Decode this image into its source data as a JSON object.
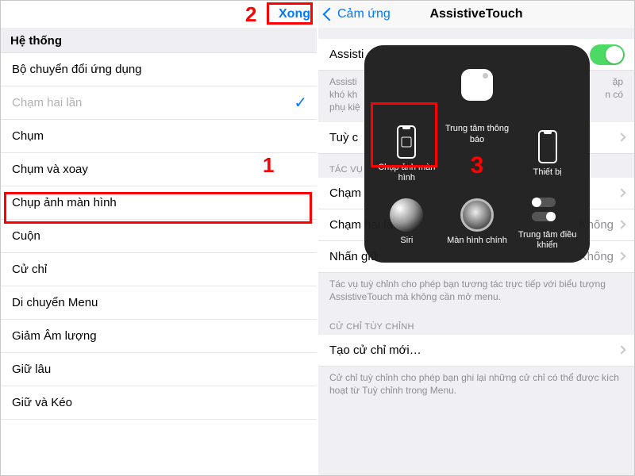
{
  "left": {
    "nav": {
      "done": "Xong"
    },
    "section": "Hệ thống",
    "items": [
      "Bộ chuyển đổi ứng dụng",
      "Chạm hai lần",
      "Chụm",
      "Chụm và xoay",
      "Chụp ảnh màn hình",
      "Cuộn",
      "Cử chỉ",
      "Di chuyển Menu",
      "Giảm Âm lượng",
      "Giữ lâu",
      "Giữ và Kéo"
    ],
    "steps": {
      "one": "1",
      "two": "2"
    }
  },
  "right": {
    "nav": {
      "back": "Cảm ứng",
      "title": "AssistiveTouch"
    },
    "assistive_row": "Assisti",
    "assistive_desc_a": "Assisti",
    "assistive_desc_b": "khó kh",
    "assistive_desc_c": "phụ kiệ",
    "assistive_desc_tail_a": "ặp",
    "assistive_desc_tail_b": "n có",
    "customize": "Tuỳ c",
    "section_actions": "TÁC VỤ",
    "actions": [
      {
        "label": "Chạm",
        "value": ""
      },
      {
        "label": "Chạm hai lần",
        "value": "Không"
      },
      {
        "label": "Nhấn giữ",
        "value": "Không"
      }
    ],
    "actions_footer": "Tác vụ tuỳ chỉnh cho phép bạn tương tác trực tiếp với biểu tượng AssistiveTouch mà không cần mở menu.",
    "section_gestures": "CỬ CHỈ TÙY CHỈNH",
    "create_gesture": "Tạo cử chỉ mới…",
    "gestures_footer": "Cử chỉ tuỳ chỉnh cho phép bạn ghi lại những cử chỉ có thể được kích hoạt từ Tuỳ chỉnh trong Menu."
  },
  "atouch": {
    "labels": {
      "notif": "Trung tâm thông báo",
      "screenshot": "Chụp ảnh màn hình",
      "device": "Thiết bị",
      "siri": "Siri",
      "home": "Màn hình chính",
      "cc": "Trung tâm điều khiển"
    },
    "step_three": "3"
  }
}
